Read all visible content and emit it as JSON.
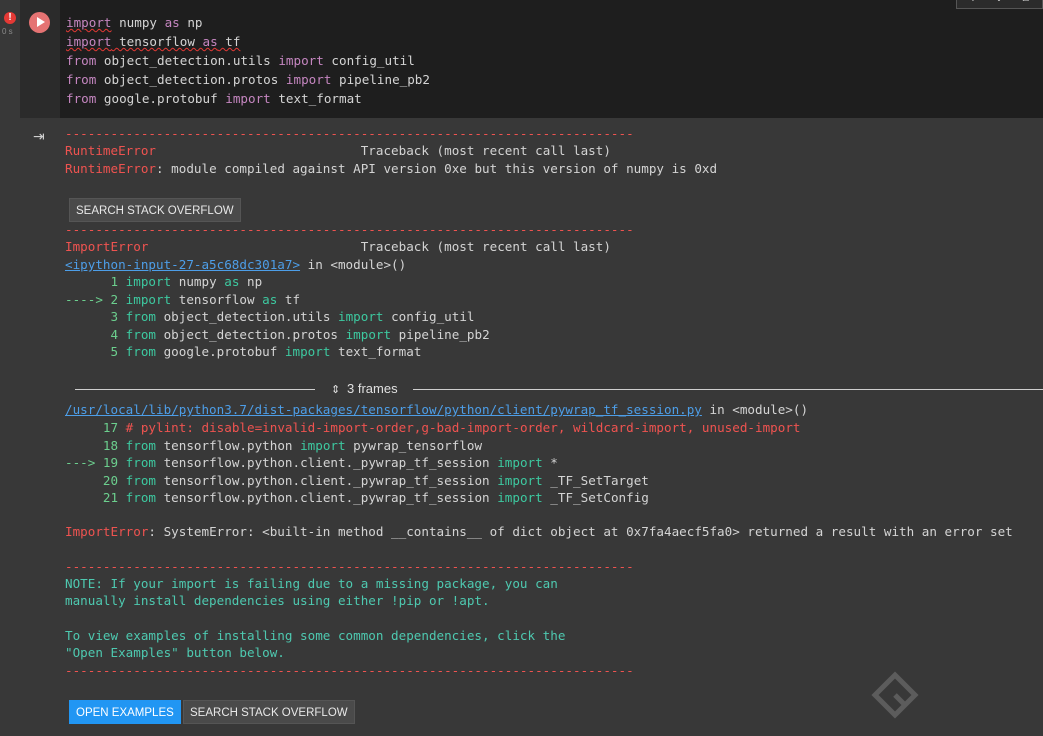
{
  "gutter": {
    "error_badge": "!",
    "exec_time": "0 s"
  },
  "code": {
    "lines": [
      [
        {
          "t": "import",
          "c": "kw sq"
        },
        {
          "t": " numpy ",
          "c": ""
        },
        {
          "t": "as",
          "c": "kw"
        },
        {
          "t": " np",
          "c": ""
        }
      ],
      [
        {
          "t": "import",
          "c": "kw sq"
        },
        {
          "t": " tensorflow ",
          "c": "sq"
        },
        {
          "t": "as",
          "c": "kw sq"
        },
        {
          "t": " tf",
          "c": "sq"
        }
      ],
      [
        {
          "t": "from",
          "c": "kw"
        },
        {
          "t": " object_detection.utils ",
          "c": ""
        },
        {
          "t": "import",
          "c": "kw"
        },
        {
          "t": " config_util",
          "c": ""
        }
      ],
      [
        {
          "t": "from",
          "c": "kw"
        },
        {
          "t": " object_detection.protos ",
          "c": ""
        },
        {
          "t": "import",
          "c": "kw"
        },
        {
          "t": " pipeline_pb2",
          "c": ""
        }
      ],
      [
        {
          "t": "from",
          "c": "kw"
        },
        {
          "t": " google.protobuf ",
          "c": ""
        },
        {
          "t": "import",
          "c": "kw"
        },
        {
          "t": " text_format",
          "c": ""
        }
      ]
    ]
  },
  "toolbar": {
    "icons": [
      "arrow-up-icon",
      "arrow-down-icon",
      "link-icon"
    ],
    "glyphs": [
      "↑",
      "↓",
      "⧉"
    ]
  },
  "output": {
    "dash_line": "---------------------------------------------------------------------------",
    "block1": {
      "err_name": "RuntimeError",
      "traceback_label": "Traceback (most recent call last)",
      "err_msg_name": "RuntimeError",
      "err_msg": ": module compiled against API version 0xe but this version of numpy is 0xd"
    },
    "search_so_1": "SEARCH STACK OVERFLOW",
    "block2": {
      "err_name": "ImportError",
      "traceback_label": "Traceback (most recent call last)",
      "input_link": "<ipython-input-27-a5c68dc301a7>",
      "in_module": " in <module>()",
      "lines": [
        [
          {
            "t": "      1 ",
            "c": "green2"
          },
          {
            "t": "import",
            "c": "kwg"
          },
          {
            "t": " numpy ",
            "c": "dim"
          },
          {
            "t": "as",
            "c": "kwg"
          },
          {
            "t": " np",
            "c": "dim"
          }
        ],
        [
          {
            "t": "----> 2 ",
            "c": "green2"
          },
          {
            "t": "import",
            "c": "kwg"
          },
          {
            "t": " tensorflow ",
            "c": "dim"
          },
          {
            "t": "as",
            "c": "kwg"
          },
          {
            "t": " tf",
            "c": "dim"
          }
        ],
        [
          {
            "t": "      3 ",
            "c": "green2"
          },
          {
            "t": "from",
            "c": "kwg"
          },
          {
            "t": " object_detection.utils ",
            "c": "dim"
          },
          {
            "t": "import",
            "c": "kwg"
          },
          {
            "t": " config_util",
            "c": "dim"
          }
        ],
        [
          {
            "t": "      4 ",
            "c": "green2"
          },
          {
            "t": "from",
            "c": "kwg"
          },
          {
            "t": " object_detection.protos ",
            "c": "dim"
          },
          {
            "t": "import",
            "c": "kwg"
          },
          {
            "t": " pipeline_pb2",
            "c": "dim"
          }
        ],
        [
          {
            "t": "      5 ",
            "c": "green2"
          },
          {
            "t": "from",
            "c": "kwg"
          },
          {
            "t": " google.protobuf ",
            "c": "dim"
          },
          {
            "t": "import",
            "c": "kwg"
          },
          {
            "t": " text_format",
            "c": "dim"
          }
        ]
      ]
    },
    "frames_label": "3 frames",
    "block3": {
      "file_link": "/usr/local/lib/python3.7/dist-packages/tensorflow/python/client/pywrap_tf_session.py",
      "in_module": " in <module>()",
      "lines": [
        [
          {
            "t": "     17 ",
            "c": "green2"
          },
          {
            "t": "# pylint: disable=invalid-import-order,g-bad-import-order, wildcard-import, unused-import",
            "c": "red"
          }
        ],
        [
          {
            "t": "     18 ",
            "c": "green2"
          },
          {
            "t": "from",
            "c": "kwg"
          },
          {
            "t": " tensorflow.python ",
            "c": "dim"
          },
          {
            "t": "import",
            "c": "kwg"
          },
          {
            "t": " pywrap_tensorflow",
            "c": "dim"
          }
        ],
        [
          {
            "t": "---> 19 ",
            "c": "green2"
          },
          {
            "t": "from",
            "c": "kwg"
          },
          {
            "t": " tensorflow.python.client._pywrap_tf_session ",
            "c": "dim"
          },
          {
            "t": "import",
            "c": "kwg"
          },
          {
            "t": " *",
            "c": "dim"
          }
        ],
        [
          {
            "t": "     20 ",
            "c": "green2"
          },
          {
            "t": "from",
            "c": "kwg"
          },
          {
            "t": " tensorflow.python.client._pywrap_tf_session ",
            "c": "dim"
          },
          {
            "t": "import",
            "c": "kwg"
          },
          {
            "t": " _TF_SetTarget",
            "c": "dim"
          }
        ],
        [
          {
            "t": "     21 ",
            "c": "green2"
          },
          {
            "t": "from",
            "c": "kwg"
          },
          {
            "t": " tensorflow.python.client._pywrap_tf_session ",
            "c": "dim"
          },
          {
            "t": "import",
            "c": "kwg"
          },
          {
            "t": " _TF_SetConfig",
            "c": "dim"
          }
        ]
      ]
    },
    "final_error": {
      "name": "ImportError",
      "msg": ": SystemError: <built-in method __contains__ of dict object at 0x7fa4aecf5fa0> returned a result with an error set"
    },
    "note": {
      "line1": "NOTE: If your import is failing due to a missing package, you can",
      "line2": "manually install dependencies using either !pip or !apt.",
      "line3": "To view examples of installing some common dependencies, click the",
      "line4": "\"Open Examples\" button below."
    },
    "open_examples": "OPEN EXAMPLES",
    "search_so_2": "SEARCH STACK OVERFLOW"
  },
  "colors": {
    "error_red": "#ef5350",
    "keyword_purple": "#c586c0",
    "link_blue": "#4d9ee8",
    "primary_blue": "#2196f3",
    "note_green": "#4ec9b0"
  }
}
